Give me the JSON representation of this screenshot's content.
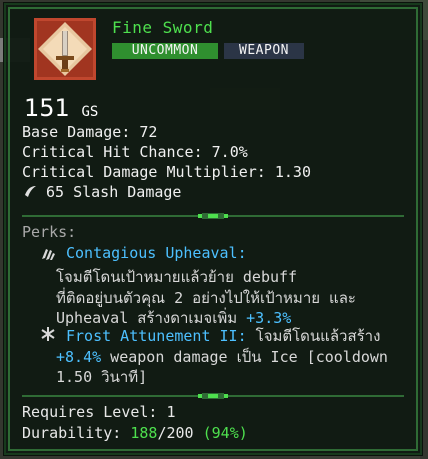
{
  "item": {
    "name": "Fine Sword",
    "rarity": "UNCOMMON",
    "type": "WEAPON",
    "icon": "sword-icon",
    "gear_score": "151",
    "gear_score_unit": "GS"
  },
  "stats": {
    "base_damage": "Base Damage: 72",
    "crit_chance": "Critical Hit Chance: 7.0%",
    "crit_mult": "Critical Damage Multiplier: 1.30",
    "slash": "65 Slash Damage",
    "slash_icon": "slash-icon"
  },
  "perks": {
    "label": "Perks:",
    "perk1": {
      "icon": "claw-icon",
      "name": "Contagious Upheaval:",
      "desc_line1": "โจมตีโดนเป้าหมายแล้วย้าย debuff",
      "desc_line2": "ที่ติดอยู่บนตัวคุณ 2 อย่างไปให้เป้าหมาย และ",
      "desc_line3_a": "Upheaval สร้างดาเมจเพิ่ม ",
      "desc_line3_b": "+3.3%"
    },
    "perk2": {
      "icon": "snowflake-icon",
      "name": "Frost Attunement II:",
      "desc_line1_a": " โจมตีโดนแล้วสร้าง",
      "desc_line2_a": "+8.4%",
      "desc_line2_b": " weapon damage เป็น Ice [cooldown",
      "desc_line3": "1.50 วินาที]"
    }
  },
  "requirements": {
    "level": "Requires Level: 1",
    "durability_label": "Durability: ",
    "durability_current": "188",
    "durability_sep": "/200 ",
    "durability_pct": "(94%)"
  },
  "colors": {
    "title": "#4ee04e",
    "rarity_badge": "#2f8f2f",
    "type_badge": "#2b3546",
    "perk_name": "#4dc0ff",
    "bonus": "#4ee04e",
    "border": "#2f6b35"
  }
}
